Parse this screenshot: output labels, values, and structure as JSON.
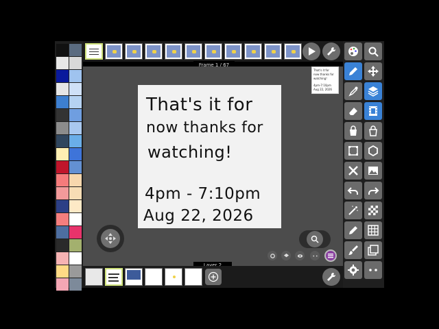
{
  "frame_label": "Frame 1 / 67",
  "layer_label": "Layer 2",
  "canvas": {
    "line1": "That's it for",
    "line2": "now thanks for",
    "line3": "watching!",
    "line4": "4pm - 7:10pm",
    "line5": "Aug 22, 2026"
  },
  "preview_text": [
    "That's it for",
    "now thanks for",
    "watching!",
    "4pm-7:10pm",
    "Aug 22, 2026"
  ],
  "colors": {
    "accent": "#3a82d6",
    "current_frame_border": "#cfe27a",
    "menu_button": "#8a3fa0"
  },
  "palette_colors": [
    "#111111",
    "#5a6b80",
    "#e8e8e8",
    "#d9d9d9",
    "#0a1a9c",
    "#9fc3ef",
    "#e6e6e6",
    "#cfe0f7",
    "#3d7fd0",
    "#b5d2f2",
    "#333333",
    "#6f9ee0",
    "#8c8c8c",
    "#a9c8ef",
    "#30465e",
    "#6aaee8",
    "#ffefb3",
    "#3e74d9",
    "#c0152b",
    "#6390d2",
    "#f57b7b",
    "#f7d7ad",
    "#f29a9a",
    "#f7ddb5",
    "#2c3f86",
    "#fde9c6",
    "#f47e7e",
    "#ffffff",
    "#4d6ea0",
    "#e8336b",
    "#2a2a2a",
    "#a3b06e",
    "#f6b3b3",
    "#ffffff",
    "#ffda85",
    "#9a9a9a",
    "#f4a6b4",
    "#7d8a9a"
  ],
  "frames_count_visible": 11,
  "tools": [
    [
      "palette-icon",
      "magnifier-icon"
    ],
    [
      "pen-icon",
      "move-icon"
    ],
    [
      "eyedropper-icon",
      "layers-icon"
    ],
    [
      "eraser-icon",
      "film-icon"
    ],
    [
      "bucket-fill-icon",
      "bucket-outline-icon"
    ],
    [
      "selection-icon",
      "hexagon-icon"
    ],
    [
      "tools-icon",
      "image-icon"
    ],
    [
      "undo-icon",
      "redo-icon"
    ],
    [
      "magic-wand-icon",
      "checker-icon"
    ],
    [
      "pencil-icon",
      "grid-icon"
    ],
    [
      "brush-icon",
      "overlay-icon"
    ],
    [
      "gear-icon",
      "more-icon"
    ]
  ]
}
